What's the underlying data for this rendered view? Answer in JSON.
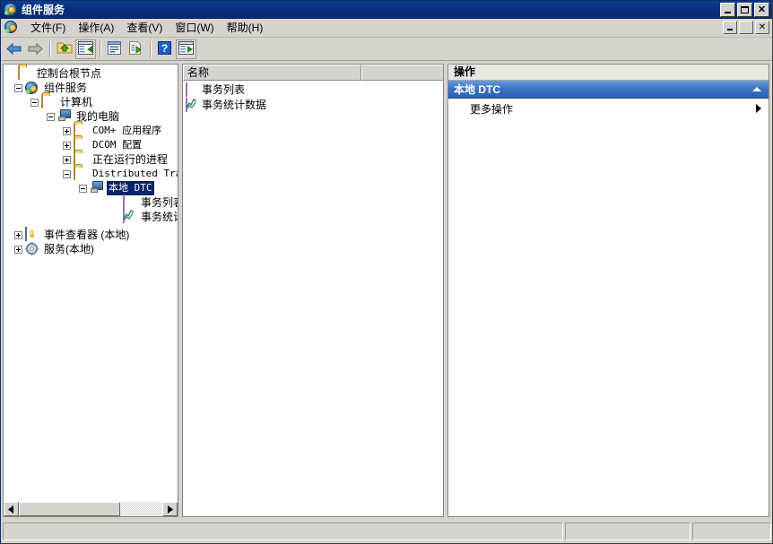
{
  "window": {
    "title": "组件服务",
    "icon": "component-services-icon",
    "controls": {
      "minimize": "最小化",
      "maximize": "最大化",
      "close": "关闭"
    },
    "mdi_controls": {
      "minimize": "最小化",
      "restore": "还原",
      "close": "关闭"
    }
  },
  "menu": {
    "icon": "component-services-icon",
    "items": [
      {
        "label": "文件(F)"
      },
      {
        "label": "操作(A)"
      },
      {
        "label": "查看(V)"
      },
      {
        "label": "窗口(W)"
      },
      {
        "label": "帮助(H)"
      }
    ]
  },
  "toolbar": {
    "buttons": [
      {
        "name": "back-button",
        "icon": "arrow-left-icon",
        "label": "后退"
      },
      {
        "name": "forward-button",
        "icon": "arrow-right-icon",
        "label": "前进"
      },
      {
        "name": "up-one-level-button",
        "icon": "folder-up-icon",
        "label": "向上一级"
      },
      {
        "name": "show-hide-tree-button",
        "icon": "console-tree-icon",
        "label": "显示/隐藏控制台树"
      },
      {
        "name": "properties-button",
        "icon": "properties-icon",
        "label": "属性"
      },
      {
        "name": "export-list-button",
        "icon": "export-list-icon",
        "label": "导出列表"
      },
      {
        "name": "help-button",
        "icon": "help-icon",
        "label": "帮助"
      },
      {
        "name": "show-hide-action-pane-button",
        "icon": "action-pane-icon",
        "label": "显示/隐藏操作窗格"
      }
    ]
  },
  "tree": {
    "nodes": [
      {
        "label": "控制台根节点",
        "icon": "folder-icon",
        "indent": 0,
        "expander": "none",
        "selected": false,
        "mono": false
      },
      {
        "label": "组件服务",
        "icon": "component-services-icon",
        "indent": 1,
        "expander": "minus",
        "selected": false,
        "mono": false
      },
      {
        "label": "计算机",
        "icon": "folder-icon",
        "indent": 2,
        "expander": "minus",
        "selected": false,
        "mono": false
      },
      {
        "label": "我的电脑",
        "icon": "computer-icon",
        "indent": 3,
        "expander": "minus",
        "selected": false,
        "mono": false
      },
      {
        "label": "COM+ 应用程序",
        "icon": "folder-icon",
        "indent": 4,
        "expander": "plus",
        "selected": false,
        "mono": false
      },
      {
        "label": "DCOM 配置",
        "icon": "folder-icon",
        "indent": 4,
        "expander": "plus",
        "selected": false,
        "mono": false
      },
      {
        "label": "正在运行的进程",
        "icon": "folder-icon",
        "indent": 4,
        "expander": "plus",
        "selected": false,
        "mono": false
      },
      {
        "label": "Distributed Tra",
        "icon": "folder-icon",
        "indent": 4,
        "expander": "minus",
        "selected": false,
        "mono": true
      },
      {
        "label": "本地 DTC",
        "icon": "computer-icon",
        "indent": 5,
        "expander": "minus",
        "selected": true,
        "mono": false
      },
      {
        "label": "事务列表",
        "icon": "transaction-list-icon",
        "indent": 6,
        "expander": "none",
        "selected": false,
        "mono": false
      },
      {
        "label": "事务统计数",
        "icon": "transaction-statistics-icon",
        "indent": 6,
        "expander": "none",
        "selected": false,
        "mono": false
      },
      {
        "label": "事件查看器 (本地)",
        "icon": "event-viewer-icon",
        "indent": 1,
        "expander": "plus",
        "selected": false,
        "mono": false
      },
      {
        "label": "服务(本地)",
        "icon": "services-icon",
        "indent": 1,
        "expander": "plus",
        "selected": false,
        "mono": false
      }
    ],
    "hscroll": {
      "left_label": "向左滚动",
      "right_label": "向右滚动"
    }
  },
  "list": {
    "columns": [
      {
        "label": "名称"
      },
      {
        "label": ""
      }
    ],
    "items": [
      {
        "label": "事务列表",
        "icon": "transaction-list-icon"
      },
      {
        "label": "事务统计数据",
        "icon": "transaction-statistics-icon"
      }
    ]
  },
  "actions": {
    "title": "操作",
    "groups": [
      {
        "header": "本地 DTC",
        "collapse_icon": "chevron-up-icon",
        "items": [
          {
            "label": "更多操作",
            "submenu_icon": "chevron-right-icon"
          }
        ]
      }
    ]
  },
  "status_bar": {
    "cells": [
      "",
      "",
      ""
    ]
  },
  "colors": {
    "title_bar": "#08307a",
    "selection": "#0a246a",
    "action_header_start": "#6a9de0",
    "action_header_end": "#2a5fae",
    "window_face": "#d6d3ce"
  }
}
